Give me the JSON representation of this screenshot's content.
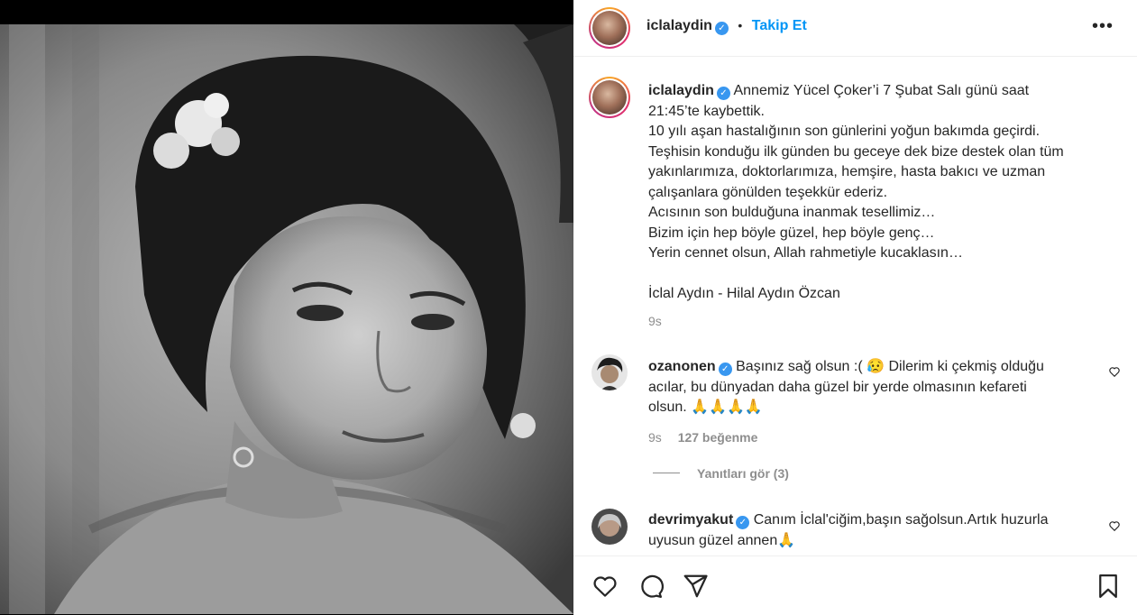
{
  "post": {
    "username": "iclalaydin",
    "follow_label": "Takip Et",
    "separator": "•",
    "more_label": "•••"
  },
  "caption": {
    "username": "iclalaydin",
    "lines": [
      "Annemiz Yücel Çoker’i 7 Şubat Salı günü saat",
      "21:45’te kaybettik.",
      "10 yılı aşan hastalığının son günlerini yoğun bakımda geçirdi.",
      "Teşhisin konduğu ilk günden bu geceye dek bize destek olan tüm",
      "yakınlarımıza, doktorlarımıza, hemşire, hasta bakıcı ve uzman",
      "çalışanlara gönülden teşekkür ederiz.",
      "Acısının son bulduğuna inanmak tesellimiz…",
      "Bizim için hep böyle güzel, hep böyle genç…",
      "Yerin cennet olsun, Allah rahmetiyle kucaklasın…"
    ],
    "signature": "İclal Aydın - Hilal Aydın Özcan",
    "time": "9s"
  },
  "comments": [
    {
      "username": "ozanonen",
      "lines": [
        "Başınız sağ olsun :( 😥 Dilerim ki çekmiş olduğu",
        "acılar, bu dünyadan daha güzel bir yerde olmasının kefareti",
        "olsun. 🙏🙏🙏🙏"
      ],
      "time": "9s",
      "likes": "127 beğenme",
      "replies": "Yanıtları gör (3)"
    },
    {
      "username": "devrimyakut",
      "lines": [
        "Canım İclal'ciğim,başın sağolsun.Artık huzurla",
        "uyusun güzel annen🙏"
      ]
    }
  ],
  "actions": {
    "icons": [
      "heart-icon",
      "comment-icon",
      "share-icon",
      "bookmark-icon"
    ]
  },
  "colors": {
    "link_blue": "#0095f6",
    "verified_blue": "#3897f0",
    "muted_gray": "#8e8e8e"
  }
}
